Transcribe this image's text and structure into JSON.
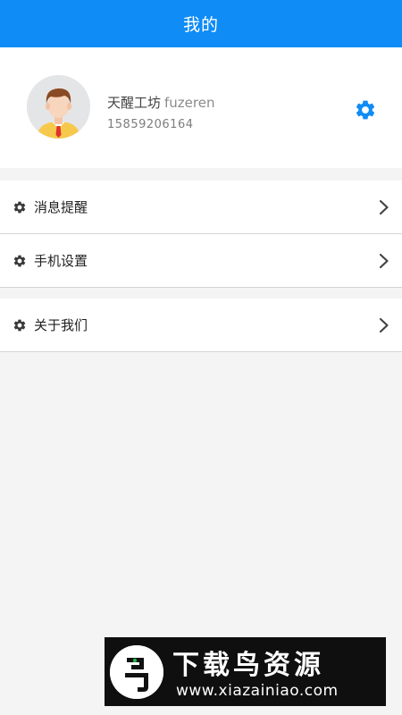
{
  "header": {
    "title": "我的"
  },
  "profile": {
    "name": "天醒工坊",
    "username": "fuzeren",
    "phone": "15859206164",
    "settings_icon": "gear-icon"
  },
  "menu_groups": [
    {
      "items": [
        {
          "label": "消息提醒",
          "icon": "gear-icon"
        },
        {
          "label": "手机设置",
          "icon": "gear-icon"
        }
      ]
    },
    {
      "items": [
        {
          "label": "关于我们",
          "icon": "gear-icon"
        }
      ]
    }
  ],
  "watermark": {
    "text": "下载鸟资源",
    "url": "www.xiazainiao.com"
  },
  "colors": {
    "header_bg": "#0f8cf6",
    "accent": "#0f8cf6",
    "page_bg": "#f4f4f4"
  }
}
